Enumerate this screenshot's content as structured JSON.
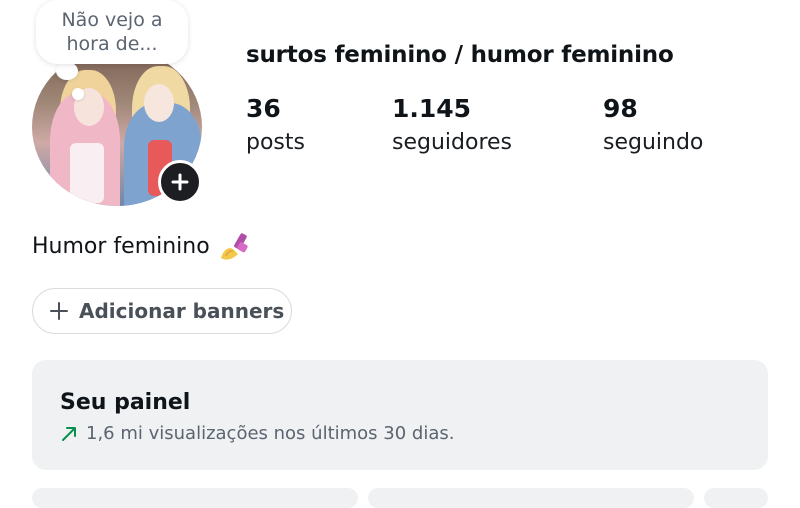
{
  "profile": {
    "note_bubble": "Não vejo a\nhora de...",
    "username": "surtos feminino / humor feminino",
    "bio": "Humor feminino",
    "bio_emoji": "nail-polish-icon"
  },
  "stats": [
    {
      "value": "36",
      "label": "posts"
    },
    {
      "value": "1.145",
      "label": "seguidores"
    },
    {
      "value": "98",
      "label": "seguindo"
    }
  ],
  "actions": {
    "add_banners_label": "Adicionar banners"
  },
  "dashboard": {
    "title": "Seu painel",
    "subtitle": "1,6 mi visualizações nos últimos 30 dias.",
    "trend_icon": "trend-up-arrow-icon"
  },
  "colors": {
    "card_bg": "#eff1f3",
    "badge_bg": "#1c1e21",
    "text_primary": "#0f1419",
    "text_secondary": "#5b6470"
  }
}
